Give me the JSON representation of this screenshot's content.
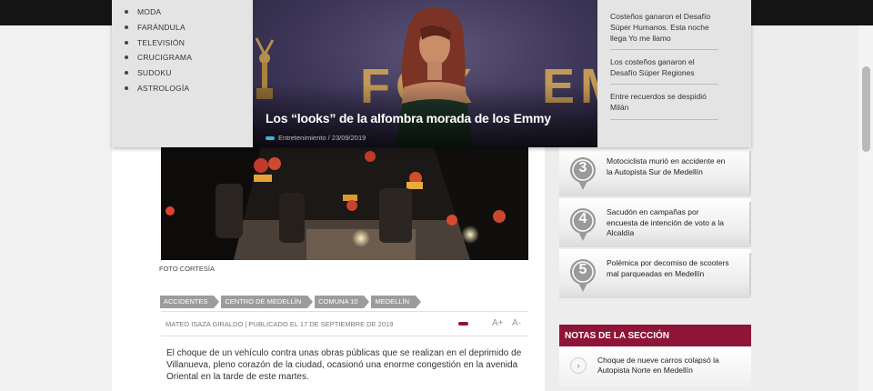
{
  "menu": {
    "items": [
      "MODA",
      "FARÁNDULA",
      "TELEVISIÓN",
      "CRUCIGRAMA",
      "SUDOKU",
      "ASTROLOGÍA"
    ]
  },
  "feature": {
    "title": "Los “looks” de la alfombra morada de los Emmy",
    "meta": "Entretenimiento / 23/09/2019"
  },
  "related": [
    "Costeños ganaron el Desafío Súper Humanos. Esta noche llega Yo me llamo",
    "Los costeños ganaron el Desafío Súper Regiones",
    "Entre recuerdos se despidió Milán"
  ],
  "article": {
    "photo_credit": "FOTO CORTESÍA",
    "tags": [
      "ACCIDENTES",
      "CENTRO DE MEDELLÍN",
      "COMUNA 10",
      "MEDELLÍN"
    ],
    "byline": "MATEO ISAZA GIRALDO | PUBLICADO EL 17 DE SEPTIEMBRE DE 2019",
    "font_up": "A+",
    "font_down": "A-",
    "body": "El choque de un vehículo contra unas obras públicas que se realizan en el deprimido de Villanueva, pleno corazón de la ciudad, ocasionó una enorme congestión en la avenida Oriental en la tarde de este martes."
  },
  "most_read": [
    {
      "rank": "3",
      "title": "Motociclista murió en accidente en la Autopista Sur de Medellín"
    },
    {
      "rank": "4",
      "title": "Sacudón en campañas por encuesta de intención de voto a la Alcaldía"
    },
    {
      "rank": "5",
      "title": "Polémica por decomiso de scooters mal parqueadas en Medellín"
    }
  ],
  "section": {
    "title": "NOTAS DE LA SECCIÓN",
    "first_item": "Choque de nueve carros colapsó la Autopista Norte en Medellín"
  },
  "colors": {
    "brand_red": "#8e1537",
    "feature_pill": "#3fb3d9",
    "top_bar": "#141414"
  }
}
